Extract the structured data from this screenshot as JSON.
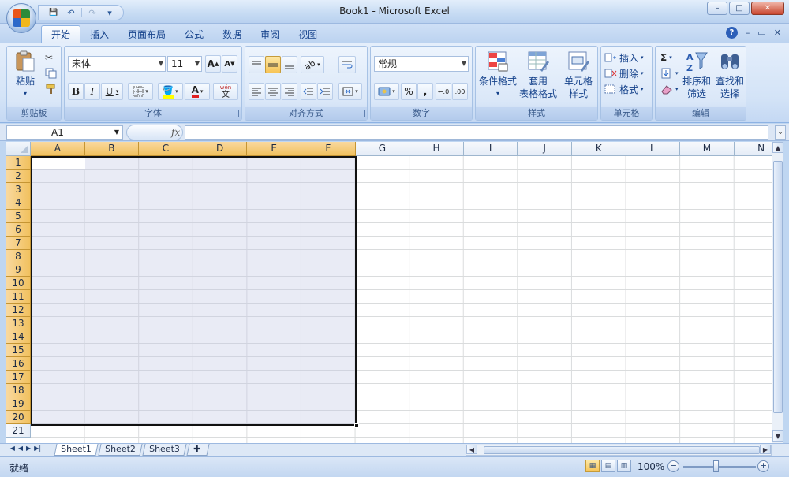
{
  "window": {
    "title": "Book1 - Microsoft Excel",
    "controls": {
      "minimize": "–",
      "restore": "□",
      "close": "✕"
    }
  },
  "quick_access": {
    "save": "💾",
    "undo": "↶",
    "redo": "↷",
    "customize": "▾"
  },
  "tabs": [
    "开始",
    "插入",
    "页面布局",
    "公式",
    "数据",
    "审阅",
    "视图"
  ],
  "active_tab": "开始",
  "tab_right": {
    "help": "?",
    "minimize": "–",
    "restore": "▭",
    "close": "✕"
  },
  "ribbon": {
    "clipboard": {
      "label": "剪贴板",
      "paste": "粘贴"
    },
    "font": {
      "label": "字体",
      "name": "宋体",
      "size": "11",
      "grow": "A",
      "shrink": "A",
      "bold": "B",
      "italic": "I",
      "underline": "U",
      "font_color": "A",
      "wen": "wén",
      "wen_char": "文"
    },
    "alignment": {
      "label": "对齐方式"
    },
    "number": {
      "label": "数字",
      "format": "常规",
      "percent": "%",
      "comma": ",",
      "inc_decimal": "←.0",
      "dec_decimal": ".00"
    },
    "styles": {
      "label": "样式",
      "conditional": "条件格式",
      "table1": "套用",
      "table2": "表格格式",
      "cell1": "单元格",
      "cell2": "样式"
    },
    "cells": {
      "label": "单元格",
      "insert": "插入",
      "delete": "删除",
      "format": "格式"
    },
    "editing": {
      "label": "编辑",
      "sigma": "Σ",
      "sort1": "排序和",
      "sort2": "筛选",
      "find1": "查找和",
      "find2": "选择"
    }
  },
  "formula_bar": {
    "name_box": "A1",
    "fx": "fx",
    "value": ""
  },
  "columns": [
    "A",
    "B",
    "C",
    "D",
    "E",
    "F",
    "G",
    "H",
    "I",
    "J",
    "K",
    "L",
    "M",
    "N"
  ],
  "selected_columns": [
    "A",
    "B",
    "C",
    "D",
    "E",
    "F"
  ],
  "rows": [
    "1",
    "2",
    "3",
    "4",
    "5",
    "6",
    "7",
    "8",
    "9",
    "10",
    "11",
    "12",
    "13",
    "14",
    "15",
    "16",
    "17",
    "18",
    "19",
    "20",
    "21"
  ],
  "selected_rows_through": 20,
  "sheets": [
    "Sheet1",
    "Sheet2",
    "Sheet3"
  ],
  "active_sheet": "Sheet1",
  "status": {
    "text": "就绪",
    "zoom": "100%",
    "zoom_out": "−",
    "zoom_in": "+"
  },
  "colors": {
    "selection_fill": "#c0c5e2",
    "header_selected": "#f4c868",
    "accent": "#15428b"
  }
}
